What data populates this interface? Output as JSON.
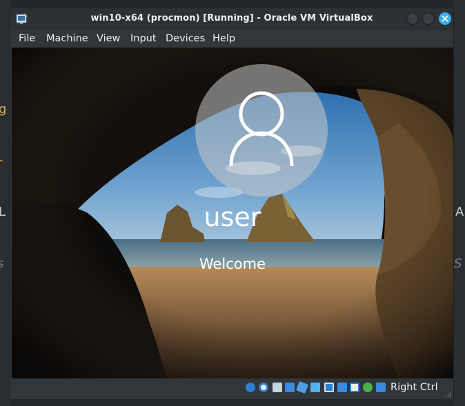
{
  "window": {
    "title": "win10-x64 (procmon) [Running] - Oracle VM VirtualBox",
    "app_icon": "virtualbox-icon",
    "controls": [
      "minimize-button",
      "maximize-button",
      "close-button"
    ]
  },
  "menubar": {
    "items": [
      {
        "label": "File"
      },
      {
        "label": "Machine"
      },
      {
        "label": "View"
      },
      {
        "label": "Input"
      },
      {
        "label": "Devices"
      },
      {
        "label": "Help"
      }
    ]
  },
  "guest_screen": {
    "lock_screen": {
      "avatar_icon": "user-avatar-icon",
      "username": "user",
      "status": "Welcome"
    }
  },
  "statusbar": {
    "icons": [
      "hard-disk-icon",
      "optical-drive-icon",
      "audio-icon",
      "network-icon",
      "usb-icon",
      "shared-folders-icon",
      "display-icon",
      "recording-icon",
      "cpu-virtualization-icon",
      "mouse-integration-icon",
      "keyboard-capture-icon"
    ],
    "host_key": "Right Ctrl"
  },
  "background_desktop": {
    "edge_glyphs_left": [
      "g",
      "-",
      "L",
      "s"
    ],
    "edge_glyphs_right": [
      "A",
      "S"
    ]
  },
  "colors": {
    "titlebar": "#2c3136",
    "menubar": "#31363b",
    "text": "#eff0f1",
    "close_button": "#3daee9",
    "avatar_circle": "rgba(200,200,200,0.55)"
  }
}
